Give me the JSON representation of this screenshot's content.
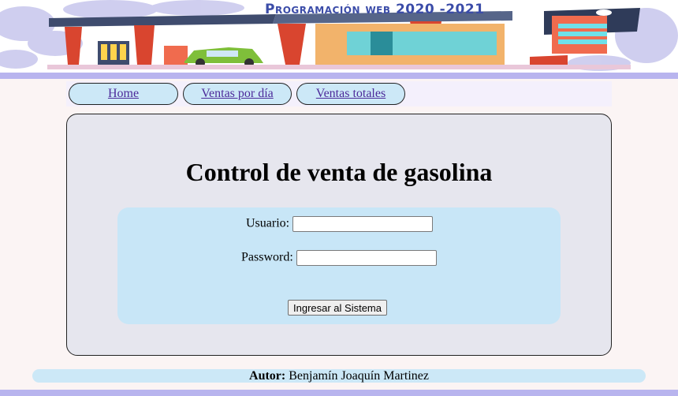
{
  "header": {
    "title": "Programación web 2020 -2021",
    "image_alt": "gas-station-illustration"
  },
  "nav": {
    "items": [
      {
        "label": "Home"
      },
      {
        "label": "Ventas por día"
      },
      {
        "label": "Ventas totales"
      }
    ]
  },
  "main": {
    "heading": "Control de venta de gasolina",
    "login": {
      "user_label": "Usuario:",
      "user_value": "",
      "password_label": "Password:",
      "password_value": "",
      "submit_label": "Ingresar al Sistema"
    }
  },
  "footer": {
    "author_label": "Autor:",
    "author_name": "Benjamín Joaquín Martinez"
  },
  "colors": {
    "band": "#b8b4ee",
    "nav_tab_bg": "#cce8f7",
    "card_bg": "#e6e6ee",
    "login_box_bg": "#c8e6f7",
    "link": "#4c2a9a"
  }
}
